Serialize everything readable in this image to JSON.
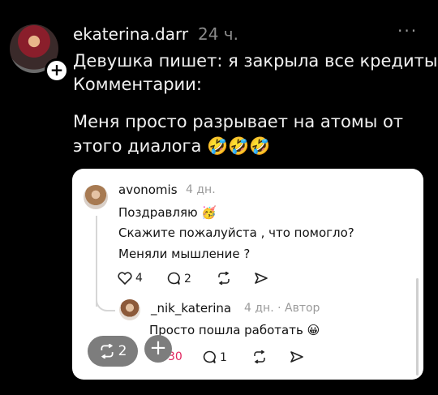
{
  "post": {
    "username": "ekaterina.darr",
    "time": "24 ч.",
    "more_icon": "ellipsis-icon",
    "lines": [
      "Девушка пишет: я закрыла все кредиты",
      "Комментарии:",
      "Меня просто разрывает на атомы от",
      "этого диалога 🤣🤣🤣"
    ]
  },
  "quote": {
    "comment": {
      "username": "avonomis",
      "time": "4 дн.",
      "lines": [
        "Поздравляю 🥳",
        "Скажите пожалуйста , что помогло?",
        "Меняли мышление ?"
      ],
      "likes": "4",
      "replies": "2"
    },
    "reply": {
      "username": "_nik_katerina",
      "meta": "4 дн. · Автор",
      "text": "Просто пошла работать 😀",
      "likes": "30",
      "replies": "1"
    }
  },
  "overlay": {
    "repost_count": "2",
    "plus": "+"
  }
}
